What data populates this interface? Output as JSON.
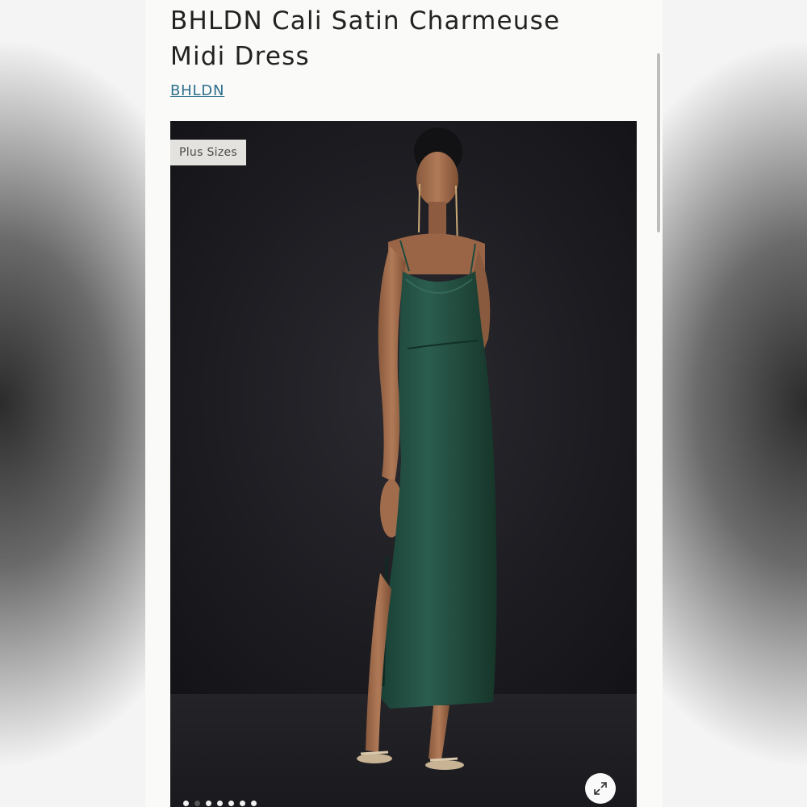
{
  "product": {
    "title": "BHLDN Cali Satin Charmeuse Midi Dress",
    "brand_link": "BHLDN"
  },
  "gallery": {
    "badge": "Plus Sizes",
    "image_alt": "Model wearing a dark green satin cowl-neck midi slip dress with a side slit and strappy heels",
    "dress_color": "#1f4a3d",
    "background_color": "#1c1c21",
    "dot_count": 7,
    "active_dot": 2,
    "expand_icon": "expand-arrows-icon"
  }
}
